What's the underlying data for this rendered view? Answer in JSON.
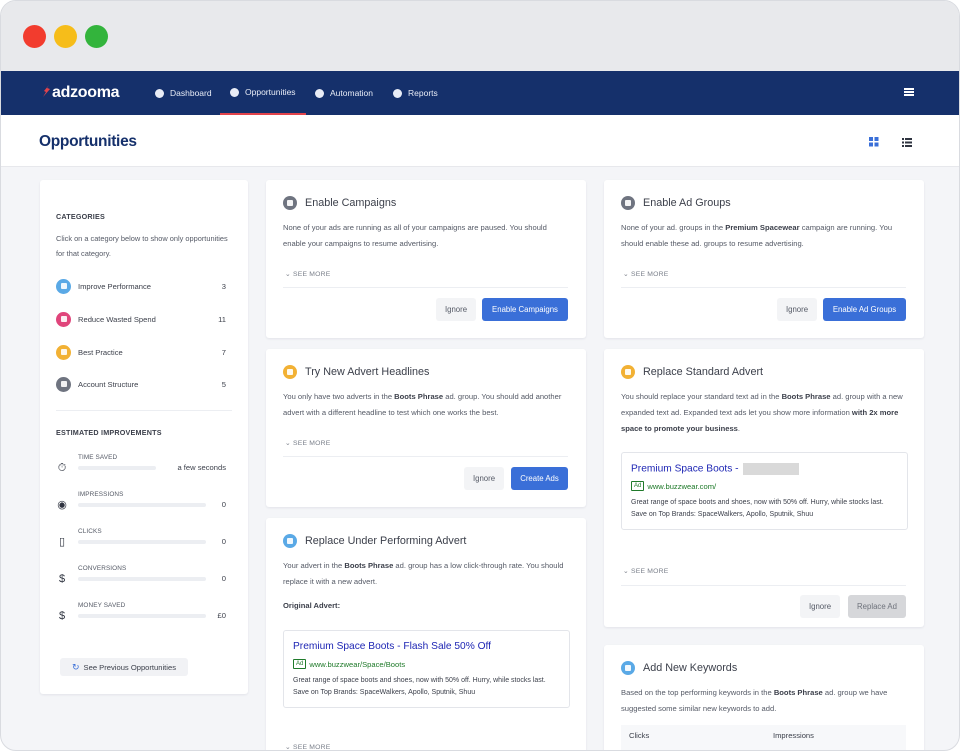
{
  "app": {
    "brand": "adzooma",
    "page_title": "Opportunities"
  },
  "nav": {
    "items": [
      {
        "label": "Dashboard",
        "icon": "compass-icon"
      },
      {
        "label": "Opportunities",
        "icon": "plus-circle-icon"
      },
      {
        "label": "Automation",
        "icon": "play-circle-icon"
      },
      {
        "label": "Reports",
        "icon": "pie-chart-icon"
      }
    ],
    "active": "Opportunities"
  },
  "sidebar": {
    "categories_title": "CATEGORIES",
    "categories_text": "Click on a category below to show only opportunities for that category.",
    "categories": [
      {
        "label": "Improve Performance",
        "count": "3",
        "color": "#5aa9e6"
      },
      {
        "label": "Reduce Wasted Spend",
        "count": "11",
        "color": "#e0457b"
      },
      {
        "label": "Best Practice",
        "count": "7",
        "color": "#f2b134"
      },
      {
        "label": "Account Structure",
        "count": "5",
        "color": "#6f7480"
      }
    ],
    "estimated_title": "ESTIMATED IMPROVEMENTS",
    "estimated": [
      {
        "label": "TIME SAVED",
        "value": "a few seconds",
        "icon": "stopwatch-icon"
      },
      {
        "label": "IMPRESSIONS",
        "value": "0",
        "icon": "eye-icon"
      },
      {
        "label": "CLICKS",
        "value": "0",
        "icon": "mouse-icon"
      },
      {
        "label": "CONVERSIONS",
        "value": "0",
        "icon": "dollar-icon"
      },
      {
        "label": "MONEY SAVED",
        "value": "£0",
        "icon": "money-saved-icon"
      }
    ],
    "previous_button": "See Previous Opportunities"
  },
  "opportunities": {
    "enable_campaigns": {
      "title": "Enable Campaigns",
      "body": "None of your ads are running as all of your campaigns are paused. You should enable your campaigns to resume advertising.",
      "see_more": "SEE MORE",
      "ignore": "Ignore",
      "action": "Enable Campaigns",
      "color": "#6f7480"
    },
    "try_headlines": {
      "title": "Try New Advert Headlines",
      "body_pre": "You only have two adverts in the ",
      "body_bold": "Boots Phrase",
      "body_post": " ad. group. You should add another advert with a different headline to test which one works the best.",
      "see_more": "SEE MORE",
      "ignore": "Ignore",
      "action": "Create Ads",
      "color": "#f2b134"
    },
    "replace_under": {
      "title": "Replace Under Performing Advert",
      "body_pre": "Your advert in the ",
      "body_bold": "Boots Phrase",
      "body_post": " ad. group has a low click-through rate. You should replace it with a new advert.",
      "original_label": "Original Advert:",
      "ad_title": "Premium Space Boots - Flash Sale 50% Off",
      "ad_badge": "Ad",
      "ad_url": "www.buzzwear/Space/Boots",
      "ad_desc": "Great range of space boots and shoes, now with 50% off. Hurry, while stocks last. Save on Top Brands: SpaceWalkers, Apollo, Sputnik, Shuu",
      "see_more": "SEE MORE",
      "color": "#5aa9e6"
    },
    "enable_ad_groups": {
      "title": "Enable Ad Groups",
      "body_pre": "None of your ad. groups in the ",
      "body_bold": "Premium Spacewear",
      "body_post": " campaign are running. You should enable these ad. groups to resume advertising.",
      "see_more": "SEE MORE",
      "ignore": "Ignore",
      "action": "Enable Ad Groups",
      "color": "#6f7480"
    },
    "replace_standard": {
      "title": "Replace Standard Advert",
      "body_pre": "You should replace your standard text ad in the ",
      "body_bold": "Boots Phrase",
      "body_mid": " ad. group with a new expanded text ad. Expanded text ads let you show more information ",
      "body_bold2": "with 2x more space to promote your business",
      "body_post": ".",
      "ad_title": "Premium Space Boots -",
      "ad_badge": "Ad",
      "ad_url": "www.buzzwear.com/",
      "ad_desc": "Great range of space boots and shoes, now with 50% off. Hurry, while stocks last. Save on Top Brands: SpaceWalkers, Apollo, Sputnik, Shuu",
      "see_more": "SEE MORE",
      "ignore": "Ignore",
      "action": "Replace Ad",
      "color": "#f2b134"
    },
    "add_keywords": {
      "title": "Add New Keywords",
      "body_pre": "Based on the top performing keywords in the ",
      "body_bold": "Boots Phrase",
      "body_post": " ad. group we have suggested some similar new keywords to add.",
      "col_clicks": "Clicks",
      "col_impressions": "Impressions",
      "color": "#5aa9e6"
    }
  },
  "colors": {
    "navbar": "#15306b",
    "active_underline": "#e2434b",
    "primary_button": "#3a6fd8"
  }
}
